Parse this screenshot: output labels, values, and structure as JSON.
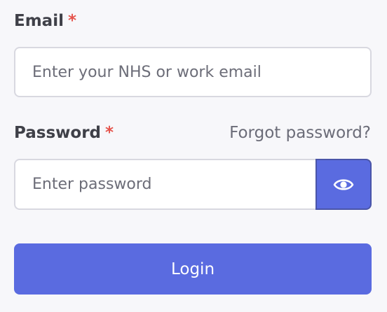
{
  "form": {
    "email": {
      "label": "Email",
      "required_mark": "*",
      "placeholder": "Enter your NHS or work email",
      "value": ""
    },
    "password": {
      "label": "Password",
      "required_mark": "*",
      "placeholder": "Enter password",
      "value": "",
      "toggle_icon": "eye-icon"
    },
    "forgot_password": "Forgot password?",
    "login_label": "Login"
  },
  "colors": {
    "background": "#f7f7fa",
    "accent": "#5a6be0",
    "required": "#e5534b",
    "text": "#3f4048",
    "muted_text": "#6b6c78"
  }
}
